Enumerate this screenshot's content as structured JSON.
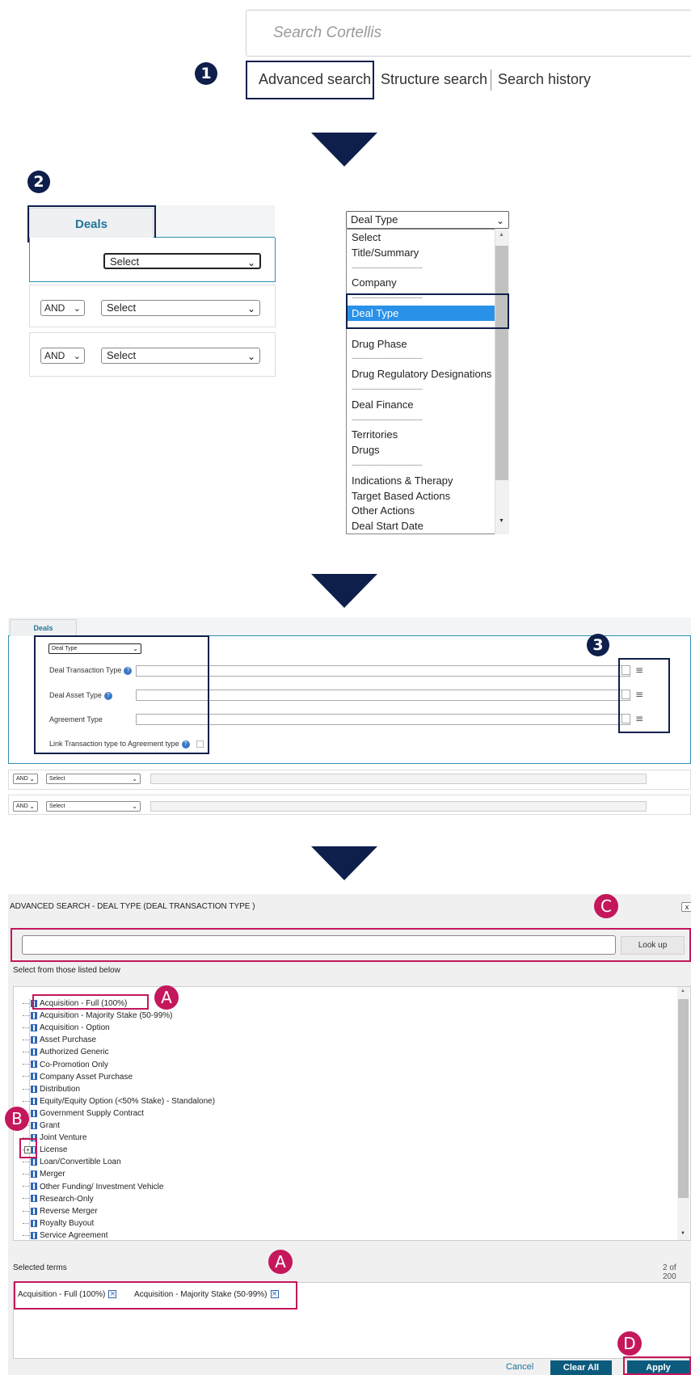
{
  "step_badges": [
    "1",
    "2",
    "3"
  ],
  "callout_badges": {
    "a1": "A",
    "b": "B",
    "c": "C",
    "a2": "A",
    "d": "D"
  },
  "search": {
    "placeholder": "Search Cortellis"
  },
  "search_links": {
    "advanced": "Advanced search",
    "structure": "Structure search",
    "history": "Search history"
  },
  "deals_form": {
    "tab": "Deals",
    "first_select": "Select",
    "rows": [
      {
        "operator": "AND",
        "field": "Select"
      },
      {
        "operator": "AND",
        "field": "Select"
      }
    ]
  },
  "field_dropdown": {
    "selected": "Deal Type",
    "options": [
      {
        "label": "Select"
      },
      {
        "label": "Title/Summary"
      },
      {
        "label": "-----------------------------------",
        "sep": true
      },
      {
        "label": "Company"
      },
      {
        "label": "-----------------------------------",
        "sep": true
      },
      {
        "label": "Deal Type",
        "highlight": true
      },
      {
        "label": "-----------------------------------",
        "sep": true
      },
      {
        "label": "Drug Phase"
      },
      {
        "label": "-----------------------------------",
        "sep": true
      },
      {
        "label": "Drug Regulatory Designations"
      },
      {
        "label": "-----------------------------------",
        "sep": true
      },
      {
        "label": "Deal Finance"
      },
      {
        "label": "-----------------------------------",
        "sep": true
      },
      {
        "label": "Territories"
      },
      {
        "label": "Drugs"
      },
      {
        "label": "-----------------------------------",
        "sep": true
      },
      {
        "label": "Indications & Therapy"
      },
      {
        "label": "Target Based Actions"
      },
      {
        "label": "Other Actions"
      },
      {
        "label": "Deal Start Date"
      }
    ]
  },
  "deal_type_form": {
    "tab": "Deals",
    "field_select": "Deal Type",
    "fields": {
      "transaction": "Deal Transaction Type",
      "asset": "Deal Asset Type",
      "agreement": "Agreement Type",
      "link": "Link Transaction type to Agreement type"
    },
    "rows": [
      {
        "operator": "AND",
        "field": "Select"
      },
      {
        "operator": "AND",
        "field": "Select"
      }
    ]
  },
  "dialog": {
    "title": "ADVANCED SEARCH - DEAL TYPE (DEAL TRANSACTION TYPE )",
    "close": "x",
    "lookup_button": "Look up",
    "select_from_label": "Select from those listed below",
    "tree_items": [
      "Acquisition - Full (100%)",
      "Acquisition - Majority Stake (50-99%)",
      "Acquisition - Option",
      "Asset Purchase",
      "Authorized Generic",
      "Co-Promotion Only",
      "Company Asset Purchase",
      "Distribution",
      "Equity/Equity Option (<50% Stake) - Standalone)",
      "Government Supply Contract",
      "Grant",
      "Joint Venture",
      "License",
      "Loan/Convertible Loan",
      "Merger",
      "Other Funding/ Investment Vehicle",
      "Research-Only",
      "Reverse Merger",
      "Royalty Buyout",
      "Service Agreement"
    ],
    "selected_terms_label": "Selected terms",
    "selected_count": "2 of 200",
    "selected_terms": [
      "Acquisition - Full (100%)",
      "Acquisition - Majority Stake (50-99%)"
    ],
    "cancel": "Cancel",
    "clear_all": "Clear All",
    "apply": "Apply"
  },
  "colors": {
    "navy": "#0f1f4b",
    "callout_pink": "#c4175c",
    "teal_button": "#0c5b7e",
    "highlight_blue": "#2a91e8"
  }
}
